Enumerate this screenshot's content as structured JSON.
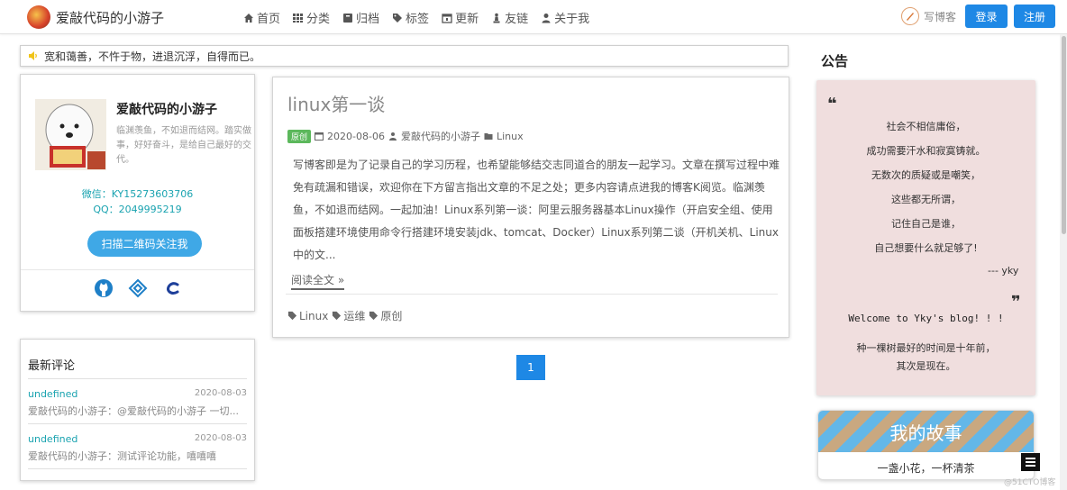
{
  "header": {
    "brand": "爱敲代码的小游子",
    "nav": [
      {
        "label": "首页",
        "icon": "home-icon"
      },
      {
        "label": "分类",
        "icon": "grid-icon"
      },
      {
        "label": "归档",
        "icon": "archive-icon"
      },
      {
        "label": "标签",
        "icon": "tags-icon"
      },
      {
        "label": "更新",
        "icon": "calendar-icon"
      },
      {
        "label": "友链",
        "icon": "chess-icon"
      },
      {
        "label": "关于我",
        "icon": "user-icon"
      }
    ],
    "write_label": "写博客",
    "login_label": "登录",
    "register_label": "注册"
  },
  "notice": "宽和蔼善，不忤于物，进退沉浮，自得而已。",
  "profile": {
    "name": "爱敲代码的小游子",
    "description": "临渊羡鱼，不如退而结网。踏实做事，好好奋斗，是给自己最好的交代。",
    "wechat": "微信：KY15273603706",
    "qq": "QQ：2049995219",
    "scan_button": "扫描二维码关注我",
    "social_icons": [
      "github-icon",
      "codepen-icon",
      "csdn-icon"
    ]
  },
  "comments": {
    "title": "最新评论",
    "items": [
      {
        "user": "undefined",
        "date": "2020-08-03",
        "text": "爱敲代码的小游子：@爱敲代码的小游子 一切..."
      },
      {
        "user": "undefined",
        "date": "2020-08-03",
        "text": "爱敲代码的小游子：测试评论功能，嘻嘻嘻"
      }
    ]
  },
  "article": {
    "title": "linux第一谈",
    "badge": "原创",
    "date": "2020-08-06",
    "author": "爱敲代码的小游子",
    "category": "Linux",
    "excerpt": "写博客即是为了记录自己的学习历程，也希望能够结交志同道合的朋友一起学习。文章在撰写过程中难免有疏漏和错误，欢迎你在下方留言指出文章的不足之处；更多内容请点进我的博客K阅览。临渊羡鱼，不如退而结网。一起加油！Linux系列第一谈：阿里云服务器基本Linux操作（开启安全组、使用面板搭建环境使用命令行搭建环境安装jdk、tomcat、Docker）Linux系列第二谈（开机关机、Linux中的文...",
    "read_more": "阅读全文 »",
    "tags": [
      "Linux",
      "运维",
      "原创"
    ]
  },
  "pagination": {
    "current": "1"
  },
  "sidebar": {
    "announce_title": "公告",
    "quote_open": "❝",
    "quote_close": "❞",
    "poem": [
      "社会不相信庸俗，",
      "成功需要汗水和寂寞铸就。",
      "无数次的质疑或是嘲笑，",
      "这些都无所谓，",
      "记住自己是谁，",
      "自己想要什么就足够了!"
    ],
    "signature": "--- yky",
    "welcome": "Welcome to Yky's blog! ! !",
    "welcome_sub": [
      "种一棵树最好的时间是十年前，",
      "其次是现在。"
    ],
    "story_title": "我的故事",
    "story_sub": "一盏小花，一杯清茶"
  },
  "watermark": "@51CTO博客"
}
